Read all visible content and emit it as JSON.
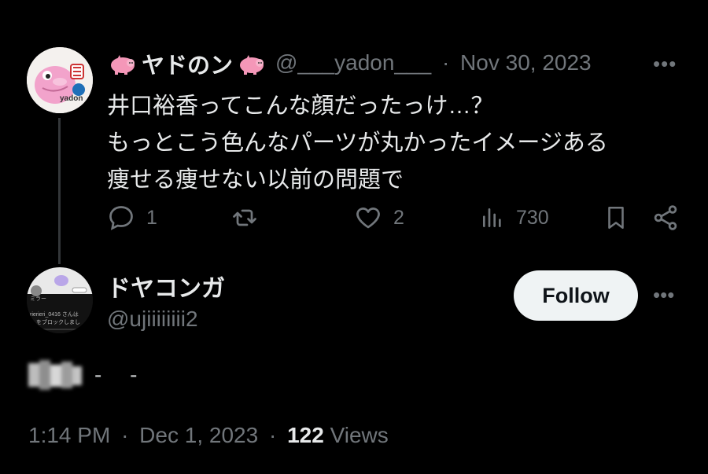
{
  "tweet": {
    "author_name": "ヤドのン",
    "handle": "@___yadon___",
    "separator": "·",
    "date": "Nov 30, 2023",
    "more": "•••",
    "avatar_text": "yadon",
    "lines": [
      "井口裕香ってこんな顔だったっけ…？",
      "もっとこう色んなパーツが丸かったイメージある",
      "痩せる痩せない以前の問題で"
    ],
    "replies": "1",
    "likes": "2",
    "views": "730"
  },
  "reply": {
    "author_name": "ドヤコンガ",
    "handle": "@ujiiiiiiii2",
    "follow_label": "Follow",
    "more": "•••",
    "avatar_lines": [
      "ミラー",
      "rierieri_0416 さんは",
      "をブロックしまし"
    ],
    "text_marks": "- -",
    "time": "1:14 PM",
    "separator": "·",
    "date": "Dec 1, 2023",
    "views_count": "122",
    "views_label": "Views"
  },
  "colors": {
    "background": "#000000",
    "text": "#e7e9ea",
    "muted": "#71767b",
    "thread_line": "#333639",
    "follow_bg": "#eff3f4",
    "avatar_pink": "#f0a0c8"
  },
  "icons": [
    "pig-emoji-icon",
    "reply-icon",
    "retweet-icon",
    "like-icon",
    "views-icon",
    "bookmark-icon",
    "share-icon",
    "more-icon"
  ]
}
